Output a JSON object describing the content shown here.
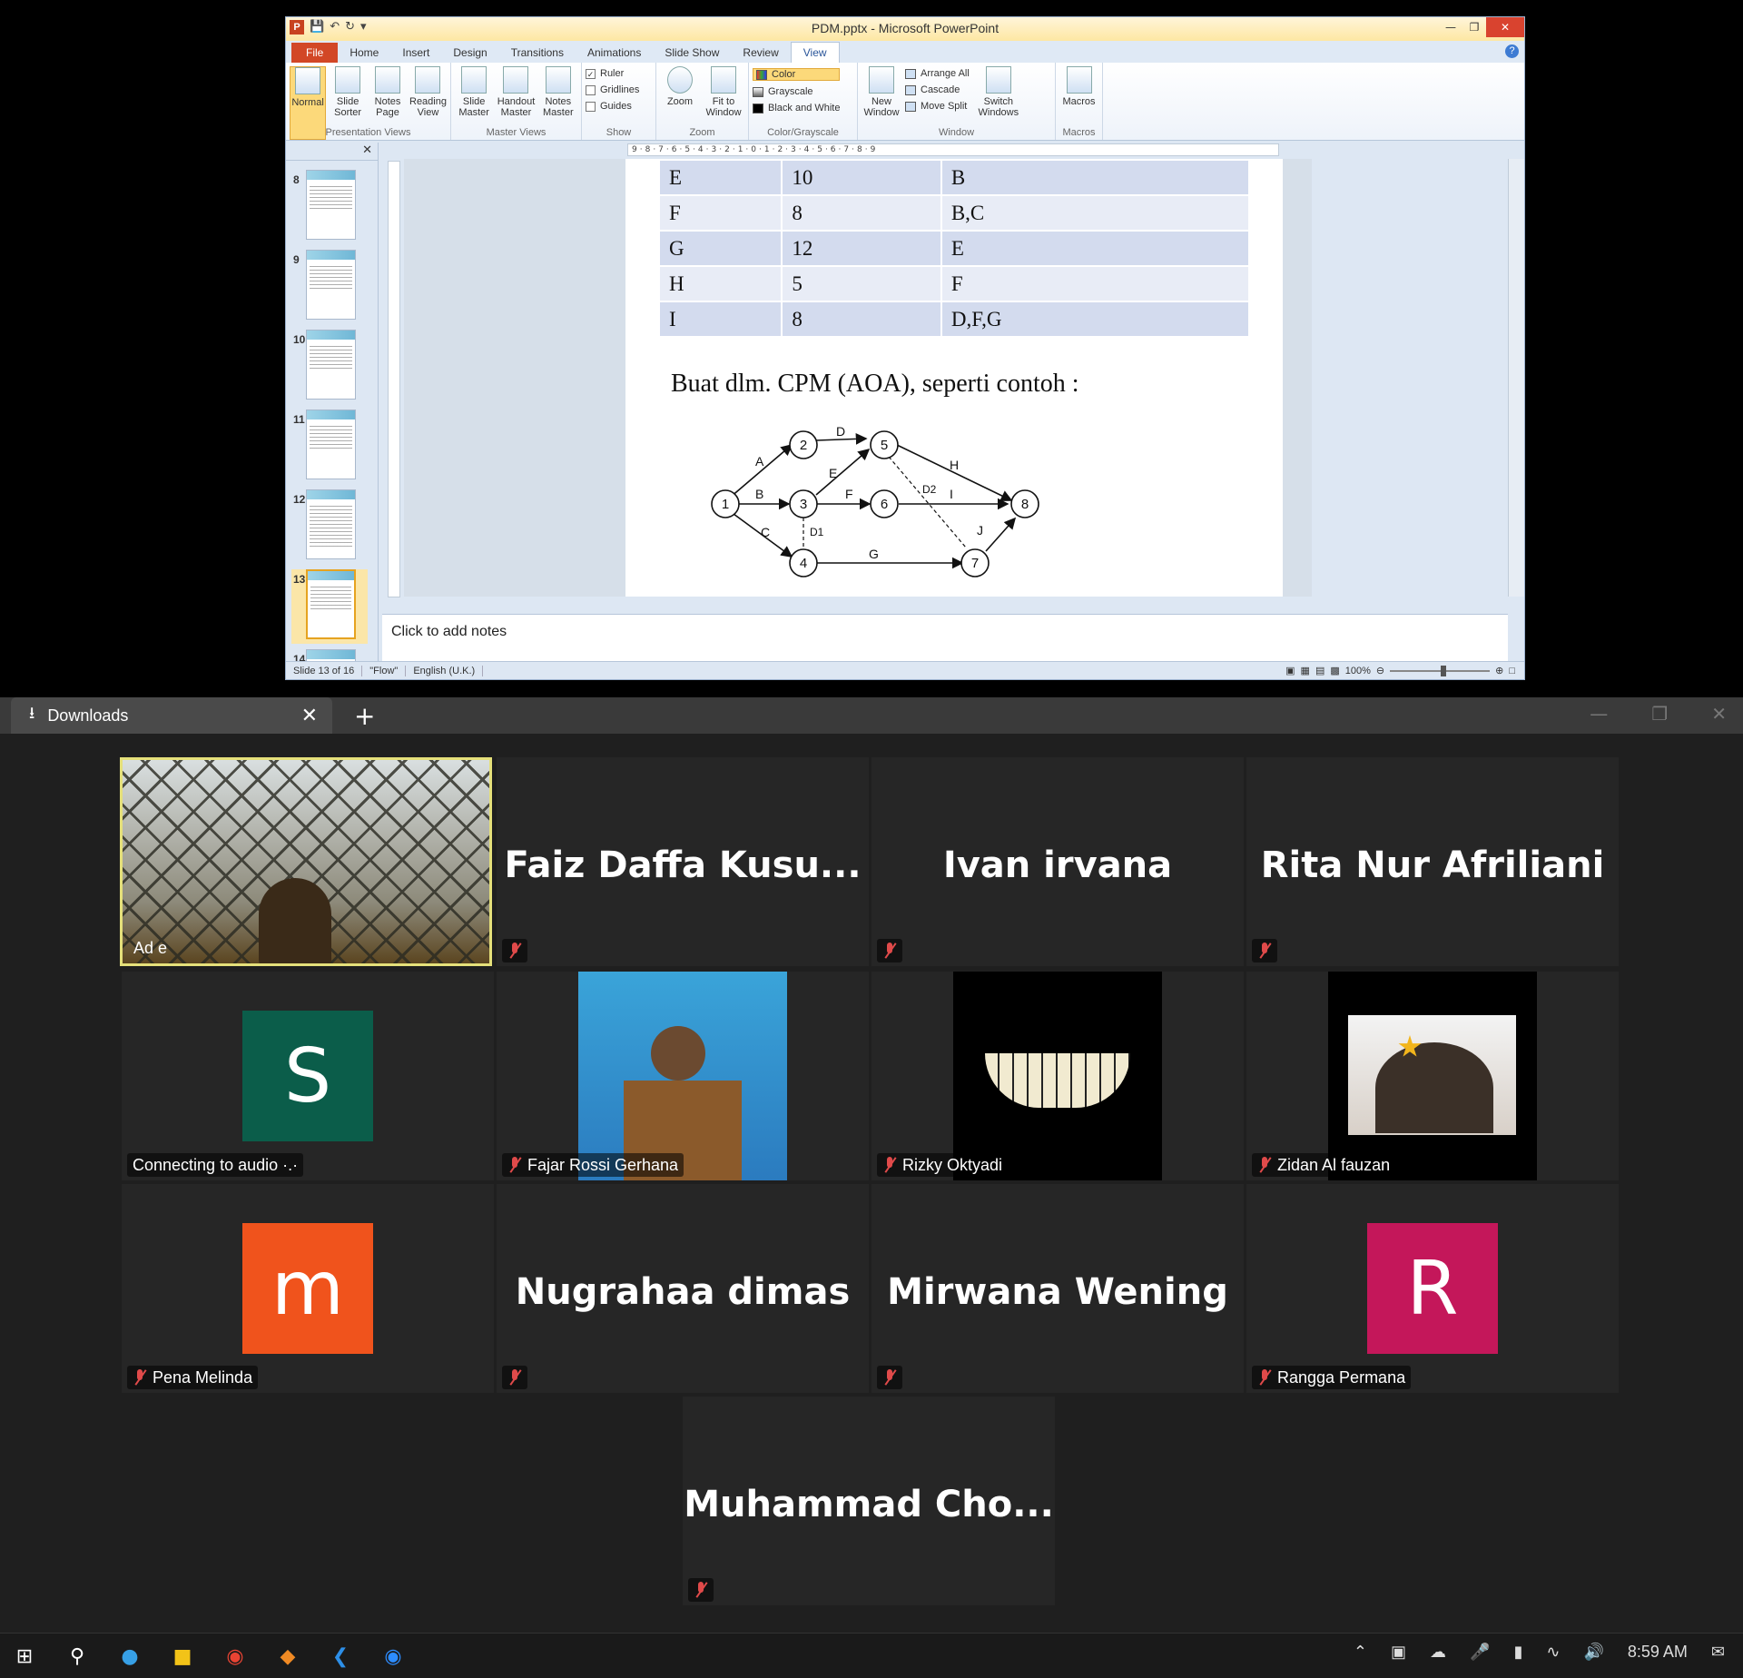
{
  "ppt": {
    "title": "PDM.pptx - Microsoft PowerPoint",
    "tabs": [
      "File",
      "Home",
      "Insert",
      "Design",
      "Transitions",
      "Animations",
      "Slide Show",
      "Review",
      "View"
    ],
    "active_tab": "View",
    "groups": {
      "presentation_views": {
        "label": "Presentation Views",
        "buttons": [
          "Normal",
          "Slide Sorter",
          "Notes Page",
          "Reading View"
        ]
      },
      "master_views": {
        "label": "Master Views",
        "buttons": [
          "Slide Master",
          "Handout Master",
          "Notes Master"
        ]
      },
      "show": {
        "label": "Show",
        "items": [
          "Ruler",
          "Gridlines",
          "Guides"
        ],
        "checked": [
          true,
          false,
          false
        ]
      },
      "zoom": {
        "label": "Zoom",
        "buttons": [
          "Zoom",
          "Fit to Window"
        ]
      },
      "color": {
        "label": "Color/Grayscale",
        "items": [
          "Color",
          "Grayscale",
          "Black and White"
        ]
      },
      "window": {
        "label": "Window",
        "new_window": "New Window",
        "items": [
          "Arrange All",
          "Cascade",
          "Move Split"
        ],
        "switch": "Switch Windows"
      },
      "macros": {
        "label": "Macros",
        "button": "Macros"
      }
    },
    "thumbnails": [
      "8",
      "9",
      "10",
      "11",
      "12",
      "13",
      "14"
    ],
    "selected_slide": "13",
    "ruler_text": "9·8·7·6·5·4·3·2·1·0·1·2·3·4·5·6·7·8·9",
    "table_rows": [
      [
        "E",
        "10",
        "B"
      ],
      [
        "F",
        "8",
        "B,C"
      ],
      [
        "G",
        "12",
        "E"
      ],
      [
        "H",
        "5",
        "F"
      ],
      [
        "I",
        "8",
        "D,F,G"
      ]
    ],
    "caption": "Buat dlm. CPM (AOA), seperti contoh :",
    "network": {
      "nodes": [
        "1",
        "2",
        "3",
        "4",
        "5",
        "6",
        "7",
        "8"
      ],
      "edges": [
        "A",
        "B",
        "C",
        "D",
        "E",
        "F",
        "G",
        "H",
        "I",
        "J"
      ],
      "dummies": [
        "D1",
        "D2"
      ]
    },
    "notes_placeholder": "Click to add notes",
    "status": {
      "slide": "Slide 13 of 16",
      "theme": "\"Flow\"",
      "language": "English (U.K.)",
      "zoom": "100%"
    }
  },
  "zoom_app": {
    "tab_label": "Downloads",
    "participants": [
      {
        "name": "Ad e",
        "kind": "video"
      },
      {
        "name": "Faiz  Daffa  Kusu...",
        "kind": "name"
      },
      {
        "name": "Ivan irvana",
        "kind": "name"
      },
      {
        "name": "Rita Nur Afriliani",
        "kind": "name"
      },
      {
        "label": "Connecting to audio ·.·",
        "initial": "S",
        "color": "#0b5d4a",
        "kind": "avatar"
      },
      {
        "name": "Fajar Rossi Gerhana",
        "kind": "photo"
      },
      {
        "name": "Rizky Oktyadi",
        "kind": "photo"
      },
      {
        "name": "Zidan Al fauzan",
        "kind": "photo"
      },
      {
        "name": "Pena Melinda",
        "initial": "m",
        "color": "#f0531c",
        "kind": "avatar"
      },
      {
        "name": "Nugrahaa dimas",
        "kind": "name"
      },
      {
        "name": "Mirwana Wening",
        "kind": "name"
      },
      {
        "name": "Rangga Permana",
        "initial": "R",
        "color": "#c4175a",
        "kind": "avatar"
      },
      {
        "name": "Muhammad  Cho...",
        "kind": "name"
      }
    ]
  },
  "taskbar": {
    "time": "8:59 AM"
  }
}
